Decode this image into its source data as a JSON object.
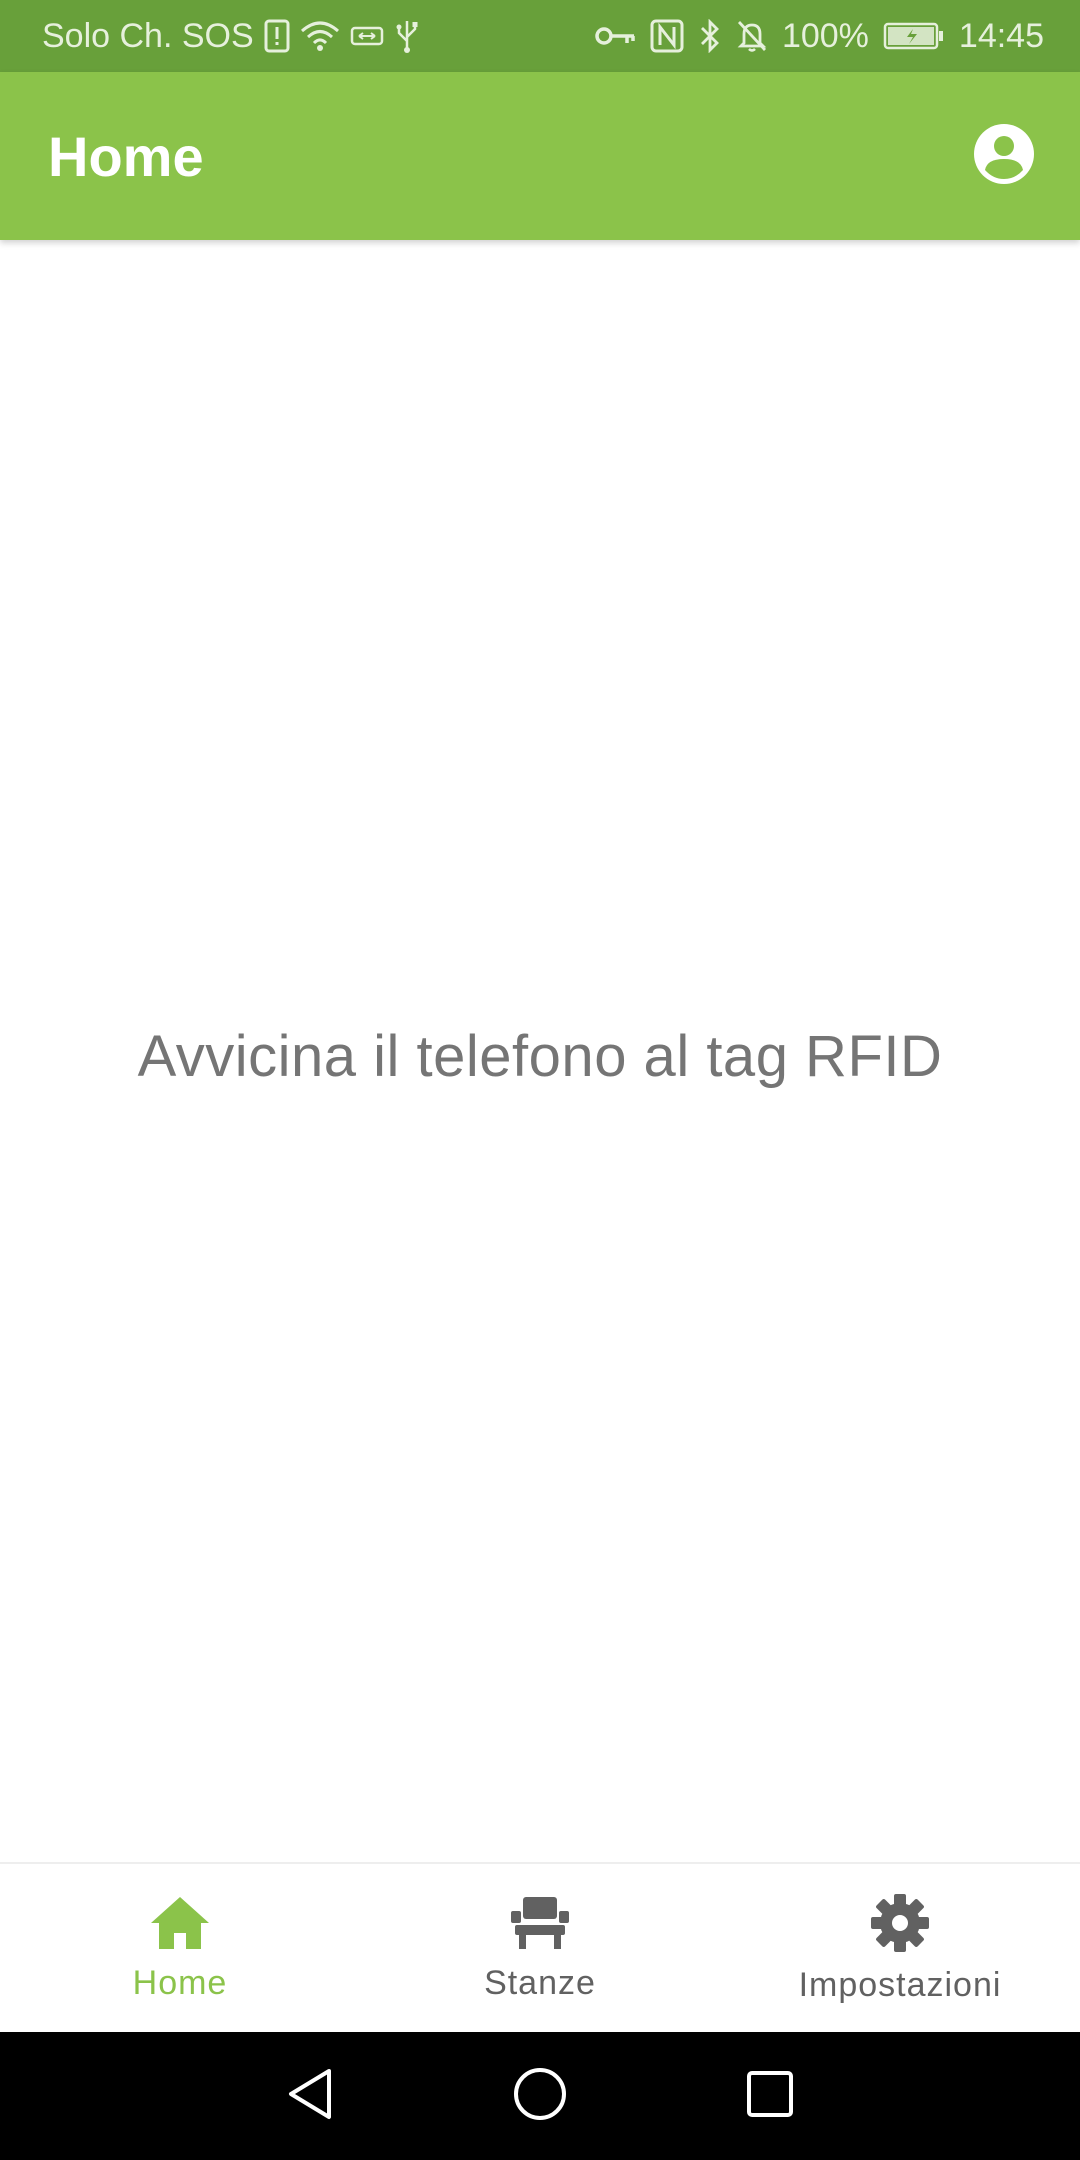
{
  "status_bar": {
    "carrier": "Solo Ch. SOS",
    "battery": "100%",
    "time": "14:45",
    "icons": [
      "sim-alert-icon",
      "wifi-icon",
      "data-saver-icon",
      "usb-icon",
      "vpn-key-icon",
      "nfc-icon",
      "bluetooth-icon",
      "silent-bell-icon",
      "battery-icon"
    ]
  },
  "app_bar": {
    "title": "Home",
    "icon": "account-circle-icon"
  },
  "main": {
    "prompt": "Avvicina il telefono al tag RFID"
  },
  "bottom_nav": {
    "items": [
      {
        "label": "Home",
        "icon": "home-icon",
        "active": true
      },
      {
        "label": "Stanze",
        "icon": "chair-icon",
        "active": false
      },
      {
        "label": "Impostazioni",
        "icon": "gear-icon",
        "active": false
      }
    ]
  },
  "system_nav": {
    "icons": [
      "back-icon",
      "home-circle-icon",
      "recents-icon"
    ]
  },
  "colors": {
    "primary": "#8bc34a",
    "status_bar": "#68a03a",
    "text_secondary": "#757575",
    "nav_inactive": "#616161"
  }
}
